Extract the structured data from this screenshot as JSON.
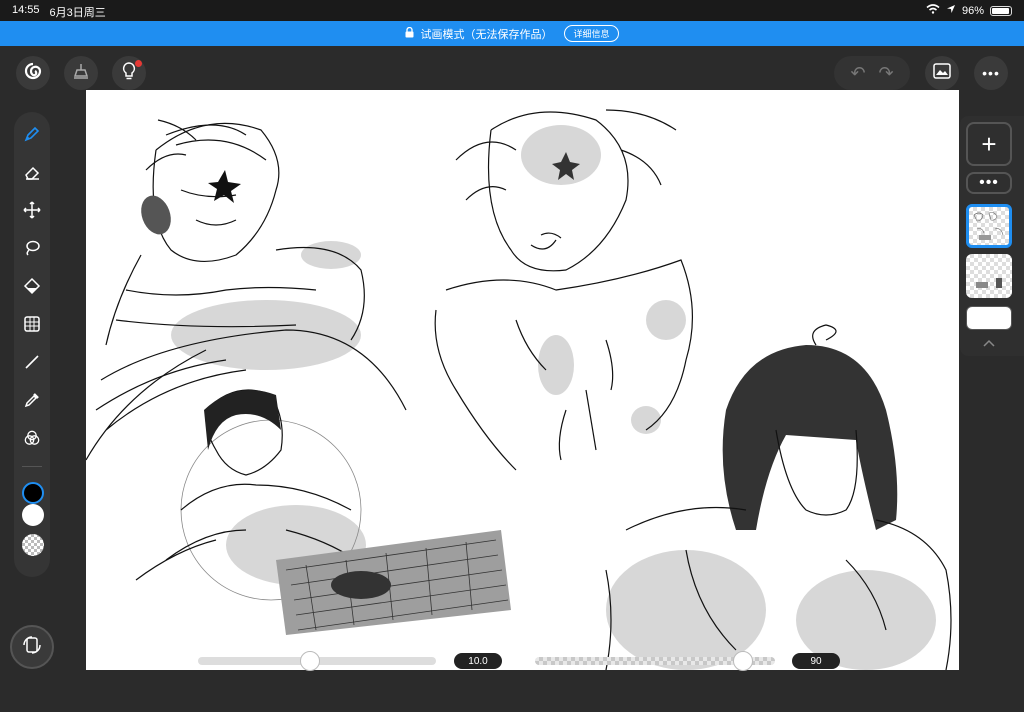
{
  "status": {
    "time": "14:55",
    "date": "6月3日周三",
    "battery": "96%",
    "battery_level": 0.96
  },
  "banner": {
    "title": "试画模式（无法保存作品）",
    "detail_label": "详细信息"
  },
  "toolbar": {
    "undo": "↶",
    "redo": "↷",
    "more": "•••"
  },
  "tools": [
    "pen",
    "eraser",
    "move",
    "lasso",
    "fill",
    "transform",
    "line",
    "eyedropper",
    "color-mixer"
  ],
  "colors": {
    "primary": "#000000",
    "secondary": "#ffffff",
    "accent": "#1f8ef1"
  },
  "layers": {
    "add_label": "+",
    "more_label": "•••",
    "count": 2,
    "active_index": 0
  },
  "sliders": {
    "brush_size": {
      "value": "10.0",
      "fraction": 0.47
    },
    "opacity": {
      "value": "90",
      "fraction": 0.9
    }
  }
}
